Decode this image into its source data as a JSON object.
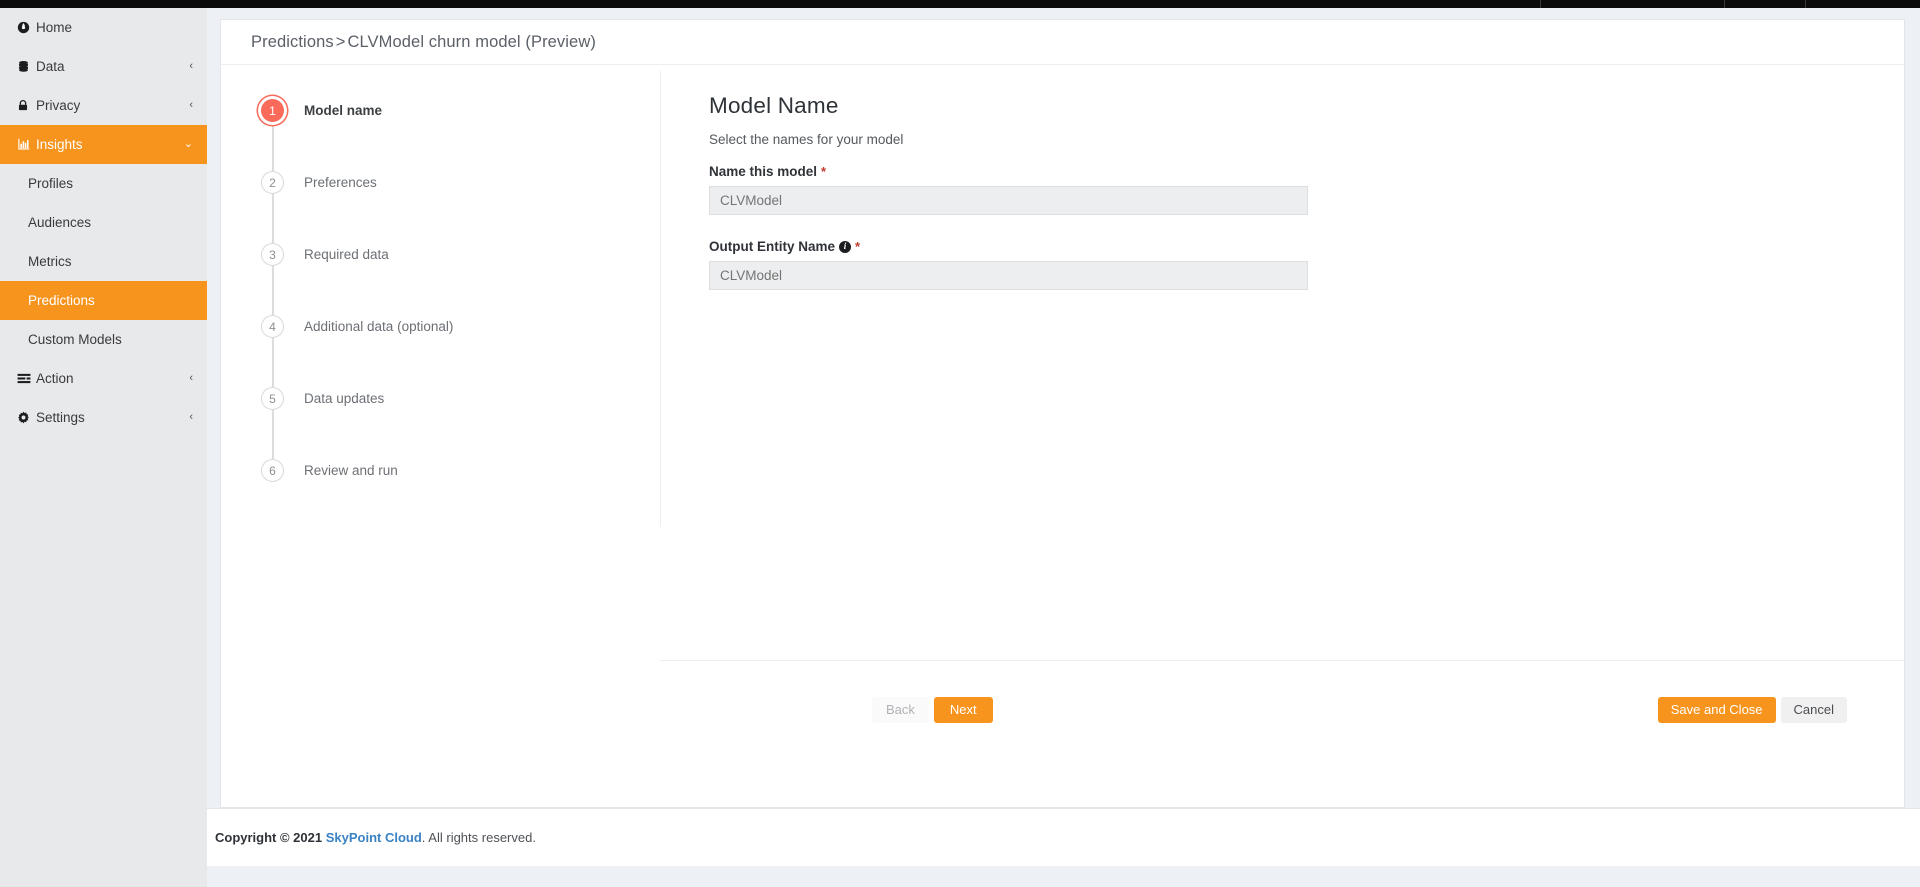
{
  "colors": {
    "accent_orange": "#F7941E",
    "step_current": "#FA6A5A",
    "brand_link": "#3A82C4",
    "sidebar_bg": "#E8E9EB",
    "page_bg": "#EDF0F4",
    "input_bg": "#ECEEF0",
    "required_red": "#C0392B"
  },
  "sidebar": {
    "items": [
      {
        "label": "Home",
        "icon": "home-icon",
        "chevron": "",
        "active": false,
        "sub": false
      },
      {
        "label": "Data",
        "icon": "database-icon",
        "chevron": "‹",
        "active": false,
        "sub": false
      },
      {
        "label": "Privacy",
        "icon": "lock-icon",
        "chevron": "‹",
        "active": false,
        "sub": false
      },
      {
        "label": "Insights",
        "icon": "chart-icon",
        "chevron": "⌄",
        "active": true,
        "sub": false
      },
      {
        "label": "Profiles",
        "icon": "",
        "chevron": "",
        "active": false,
        "sub": true
      },
      {
        "label": "Audiences",
        "icon": "",
        "chevron": "",
        "active": false,
        "sub": true
      },
      {
        "label": "Metrics",
        "icon": "",
        "chevron": "",
        "active": false,
        "sub": true
      },
      {
        "label": "Predictions",
        "icon": "",
        "chevron": "",
        "active": true,
        "sub": true
      },
      {
        "label": "Custom Models",
        "icon": "",
        "chevron": "",
        "active": false,
        "sub": true
      },
      {
        "label": "Action",
        "icon": "action-icon",
        "chevron": "‹",
        "active": false,
        "sub": false
      },
      {
        "label": "Settings",
        "icon": "gear-icon",
        "chevron": "‹",
        "active": false,
        "sub": false
      }
    ]
  },
  "breadcrumb": {
    "root": "Predictions",
    "separator": ">",
    "current": "CLVModel churn model (Preview)"
  },
  "stepper": {
    "steps": [
      {
        "number": "1",
        "label": "Model name",
        "current": true
      },
      {
        "number": "2",
        "label": "Preferences",
        "current": false
      },
      {
        "number": "3",
        "label": "Required data",
        "current": false
      },
      {
        "number": "4",
        "label": "Additional data (optional)",
        "current": false
      },
      {
        "number": "5",
        "label": "Data updates",
        "current": false
      },
      {
        "number": "6",
        "label": "Review and run",
        "current": false
      }
    ]
  },
  "form": {
    "title": "Model Name",
    "subtitle": "Select the names for your model",
    "fields": [
      {
        "label": "Name this model",
        "required_mark": "*",
        "has_info": false,
        "value": "",
        "placeholder": "CLVModel"
      },
      {
        "label": "Output Entity Name",
        "required_mark": "*",
        "has_info": true,
        "info_glyph": "i",
        "value": "",
        "placeholder": "CLVModel"
      }
    ]
  },
  "actions": {
    "back": "Back",
    "next": "Next",
    "save_and_close": "Save and Close",
    "cancel": "Cancel"
  },
  "footer": {
    "copyright_prefix": "Copyright © 2021",
    "brand": "SkyPoint Cloud",
    "copyright_suffix": ". All rights reserved."
  }
}
